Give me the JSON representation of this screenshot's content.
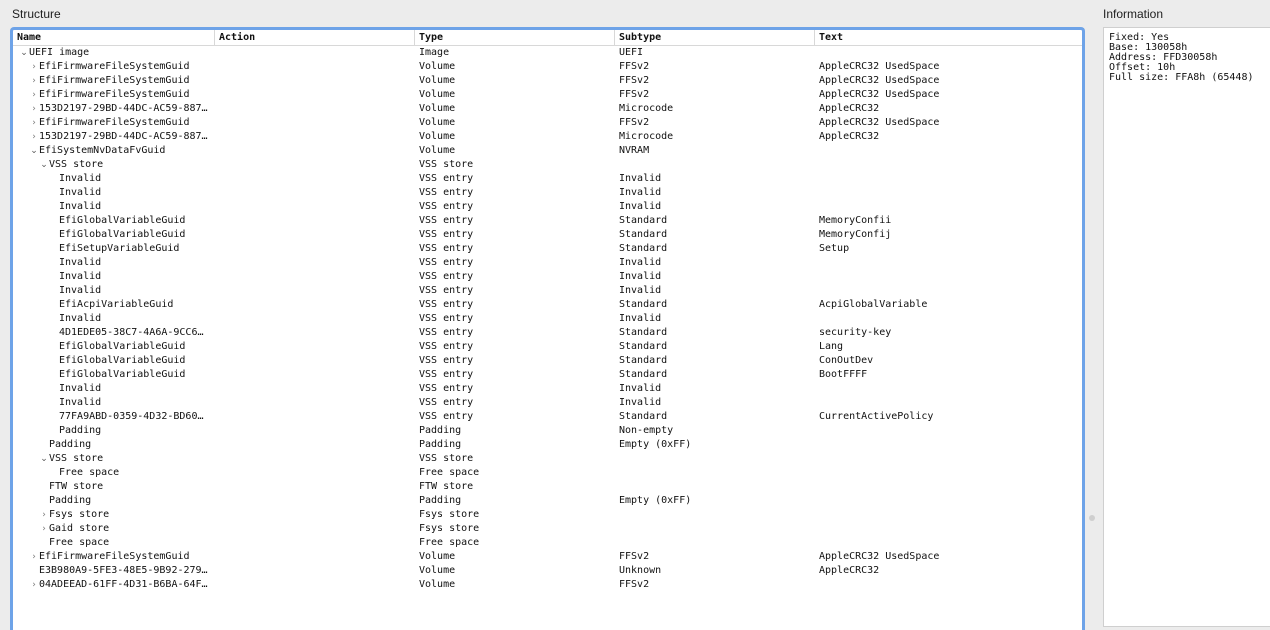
{
  "panels": {
    "structure": "Structure",
    "information": "Information"
  },
  "columns": {
    "name": "Name",
    "action": "Action",
    "type": "Type",
    "subtype": "Subtype",
    "text": "Text"
  },
  "rows": [
    {
      "depth": 0,
      "arrow": "open",
      "name": "UEFI image",
      "type": "Image",
      "subtype": "UEFI",
      "text": ""
    },
    {
      "depth": 1,
      "arrow": "closed",
      "name": "EfiFirmwareFileSystemGuid",
      "type": "Volume",
      "subtype": "FFSv2",
      "text": "AppleCRC32 UsedSpace"
    },
    {
      "depth": 1,
      "arrow": "closed",
      "name": "EfiFirmwareFileSystemGuid",
      "type": "Volume",
      "subtype": "FFSv2",
      "text": "AppleCRC32 UsedSpace"
    },
    {
      "depth": 1,
      "arrow": "closed",
      "name": "EfiFirmwareFileSystemGuid",
      "type": "Volume",
      "subtype": "FFSv2",
      "text": "AppleCRC32 UsedSpace"
    },
    {
      "depth": 1,
      "arrow": "closed",
      "name": "153D2197-29BD-44DC-AC59-887…",
      "type": "Volume",
      "subtype": "Microcode",
      "text": "AppleCRC32"
    },
    {
      "depth": 1,
      "arrow": "closed",
      "name": "EfiFirmwareFileSystemGuid",
      "type": "Volume",
      "subtype": "FFSv2",
      "text": "AppleCRC32 UsedSpace"
    },
    {
      "depth": 1,
      "arrow": "closed",
      "name": "153D2197-29BD-44DC-AC59-887…",
      "type": "Volume",
      "subtype": "Microcode",
      "text": "AppleCRC32"
    },
    {
      "depth": 1,
      "arrow": "open",
      "name": "EfiSystemNvDataFvGuid",
      "type": "Volume",
      "subtype": "NVRAM",
      "text": ""
    },
    {
      "depth": 2,
      "arrow": "open",
      "name": "VSS store",
      "type": "VSS store",
      "subtype": "",
      "text": ""
    },
    {
      "depth": 3,
      "arrow": "none",
      "name": "Invalid",
      "type": "VSS entry",
      "subtype": "Invalid",
      "text": ""
    },
    {
      "depth": 3,
      "arrow": "none",
      "name": "Invalid",
      "type": "VSS entry",
      "subtype": "Invalid",
      "text": ""
    },
    {
      "depth": 3,
      "arrow": "none",
      "name": "Invalid",
      "type": "VSS entry",
      "subtype": "Invalid",
      "text": ""
    },
    {
      "depth": 3,
      "arrow": "none",
      "name": "EfiGlobalVariableGuid",
      "type": "VSS entry",
      "subtype": "Standard",
      "text": "MemoryConfii"
    },
    {
      "depth": 3,
      "arrow": "none",
      "name": "EfiGlobalVariableGuid",
      "type": "VSS entry",
      "subtype": "Standard",
      "text": "MemoryConfij"
    },
    {
      "depth": 3,
      "arrow": "none",
      "name": "EfiSetupVariableGuid",
      "type": "VSS entry",
      "subtype": "Standard",
      "text": "Setup"
    },
    {
      "depth": 3,
      "arrow": "none",
      "name": "Invalid",
      "type": "VSS entry",
      "subtype": "Invalid",
      "text": ""
    },
    {
      "depth": 3,
      "arrow": "none",
      "name": "Invalid",
      "type": "VSS entry",
      "subtype": "Invalid",
      "text": ""
    },
    {
      "depth": 3,
      "arrow": "none",
      "name": "Invalid",
      "type": "VSS entry",
      "subtype": "Invalid",
      "text": ""
    },
    {
      "depth": 3,
      "arrow": "none",
      "name": "EfiAcpiVariableGuid",
      "type": "VSS entry",
      "subtype": "Standard",
      "text": "AcpiGlobalVariable"
    },
    {
      "depth": 3,
      "arrow": "none",
      "name": "Invalid",
      "type": "VSS entry",
      "subtype": "Invalid",
      "text": ""
    },
    {
      "depth": 3,
      "arrow": "none",
      "name": "4D1EDE05-38C7-4A6A-9CC6…",
      "type": "VSS entry",
      "subtype": "Standard",
      "text": "security-key"
    },
    {
      "depth": 3,
      "arrow": "none",
      "name": "EfiGlobalVariableGuid",
      "type": "VSS entry",
      "subtype": "Standard",
      "text": "Lang"
    },
    {
      "depth": 3,
      "arrow": "none",
      "name": "EfiGlobalVariableGuid",
      "type": "VSS entry",
      "subtype": "Standard",
      "text": "ConOutDev"
    },
    {
      "depth": 3,
      "arrow": "none",
      "name": "EfiGlobalVariableGuid",
      "type": "VSS entry",
      "subtype": "Standard",
      "text": "BootFFFF"
    },
    {
      "depth": 3,
      "arrow": "none",
      "name": "Invalid",
      "type": "VSS entry",
      "subtype": "Invalid",
      "text": ""
    },
    {
      "depth": 3,
      "arrow": "none",
      "name": "Invalid",
      "type": "VSS entry",
      "subtype": "Invalid",
      "text": ""
    },
    {
      "depth": 3,
      "arrow": "none",
      "name": "77FA9ABD-0359-4D32-BD60…",
      "type": "VSS entry",
      "subtype": "Standard",
      "text": "CurrentActivePolicy"
    },
    {
      "depth": 3,
      "arrow": "none",
      "name": "Padding",
      "type": "Padding",
      "subtype": "Non-empty",
      "text": ""
    },
    {
      "depth": 2,
      "arrow": "none",
      "name": "Padding",
      "type": "Padding",
      "subtype": "Empty (0xFF)",
      "text": ""
    },
    {
      "depth": 2,
      "arrow": "open",
      "name": "VSS store",
      "type": "VSS store",
      "subtype": "",
      "text": ""
    },
    {
      "depth": 3,
      "arrow": "none",
      "name": "Free space",
      "type": "Free space",
      "subtype": "",
      "text": ""
    },
    {
      "depth": 2,
      "arrow": "none",
      "name": "FTW store",
      "type": "FTW store",
      "subtype": "",
      "text": ""
    },
    {
      "depth": 2,
      "arrow": "none",
      "name": "Padding",
      "type": "Padding",
      "subtype": "Empty (0xFF)",
      "text": ""
    },
    {
      "depth": 2,
      "arrow": "closed",
      "name": "Fsys store",
      "type": "Fsys store",
      "subtype": "",
      "text": ""
    },
    {
      "depth": 2,
      "arrow": "closed",
      "name": "Gaid store",
      "type": "Fsys store",
      "subtype": "",
      "text": ""
    },
    {
      "depth": 2,
      "arrow": "none",
      "name": "Free space",
      "type": "Free space",
      "subtype": "",
      "text": ""
    },
    {
      "depth": 1,
      "arrow": "closed",
      "name": "EfiFirmwareFileSystemGuid",
      "type": "Volume",
      "subtype": "FFSv2",
      "text": "AppleCRC32 UsedSpace"
    },
    {
      "depth": 1,
      "arrow": "none",
      "name": "E3B980A9-5FE3-48E5-9B92-279…",
      "type": "Volume",
      "subtype": "Unknown",
      "text": "AppleCRC32"
    },
    {
      "depth": 1,
      "arrow": "closed",
      "name": "04ADEEAD-61FF-4D31-B6BA-64F…",
      "type": "Volume",
      "subtype": "FFSv2",
      "text": ""
    }
  ],
  "info": [
    "Fixed: Yes",
    "Base: 130058h",
    "Address: FFD30058h",
    "Offset: 10h",
    "Full size: FFA8h (65448)"
  ],
  "icons": {
    "collapsed": "›",
    "expanded": "⌄"
  }
}
